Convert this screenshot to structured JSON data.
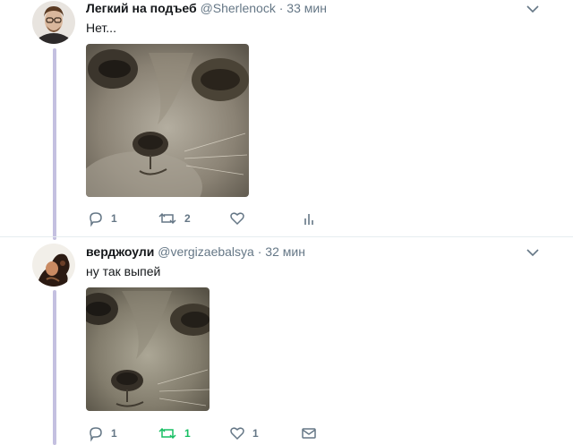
{
  "tweets": [
    {
      "name": "Легкий на подъеб",
      "handle": "@Sherlenock",
      "separator": "·",
      "time": "33 мин",
      "text": "Нет...",
      "replies": "1",
      "retweets": "2",
      "likes": "",
      "analytics_icon": "analytics-icon"
    },
    {
      "name": "верджоули",
      "handle": "@vergizaebalsya",
      "separator": "·",
      "time": "32 мин",
      "text": "ну так выпей",
      "replies": "1",
      "retweets": "1",
      "likes": "1",
      "dm_icon": "envelope-icon"
    }
  ],
  "colors": {
    "thread_line": "#c4c0e0",
    "action_gray": "#657786",
    "retweet_green": "#17bf63"
  }
}
